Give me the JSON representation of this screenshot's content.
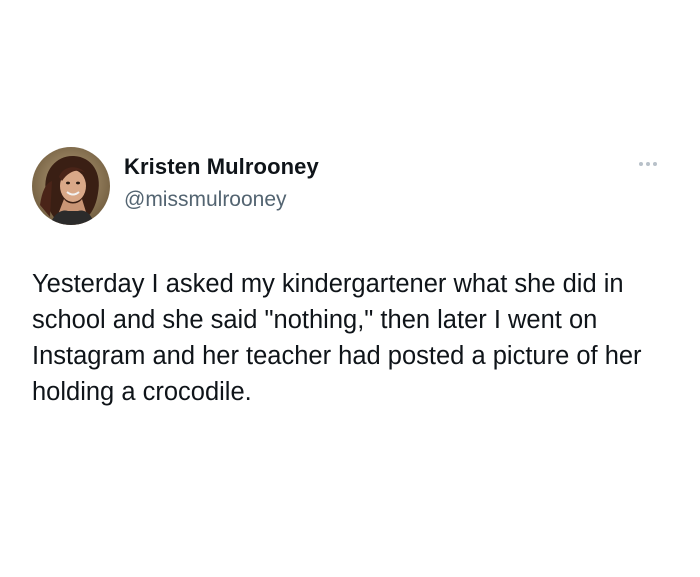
{
  "tweet": {
    "author_name": "Kristen Mulrooney",
    "author_handle": "@missmulrooney",
    "text": "Yesterday I asked my kindergartener what she did in school and she said \"nothing,\" then later I went on Instagram and her teacher had posted a picture of her holding a crocodile."
  },
  "icons": {
    "avatar": "profile-photo",
    "more": "more-options-icon"
  },
  "colors": {
    "text": "#0f1419",
    "secondary_text": "#536471",
    "more_icon": "#b8c1c9",
    "background": "#ffffff"
  }
}
